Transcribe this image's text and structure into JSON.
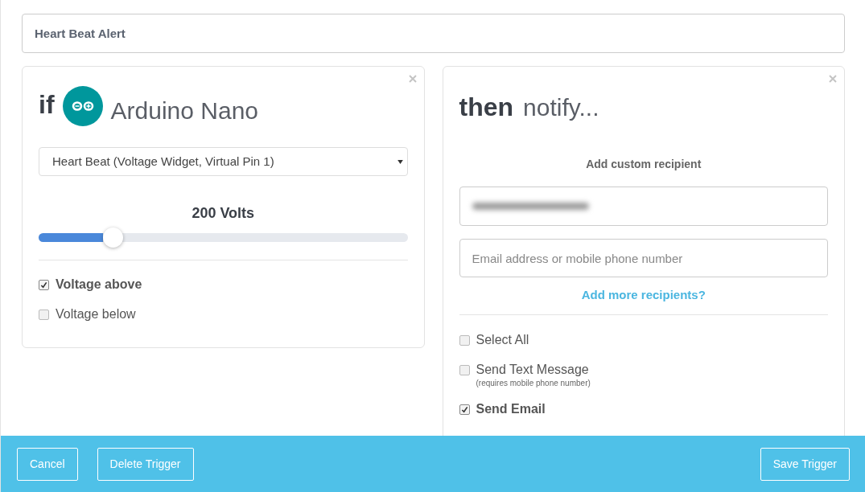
{
  "title_field": {
    "value": "Heart Beat Alert"
  },
  "condition": {
    "keyword": "if",
    "device": "Arduino Nano",
    "select": {
      "value": "Heart Beat (Voltage Widget, Virtual Pin 1)"
    },
    "threshold": {
      "reading": "200 Volts",
      "level": 0.2
    },
    "options": [
      {
        "label": "Voltage above",
        "checked": true
      },
      {
        "label": "Voltage below",
        "checked": false
      }
    ]
  },
  "action": {
    "keyword": "then",
    "verb": "notify...",
    "recipients_heading": "Add custom recipient",
    "recipients": [
      {
        "kind": "blurred"
      },
      {
        "kind": "input",
        "placeholder": "Email address or mobile phone number"
      }
    ],
    "add_more_link": "Add more recipients?",
    "options": [
      {
        "label": "Select All",
        "checked": false
      },
      {
        "label": "Send Text Message",
        "note": "(requires mobile phone number)",
        "checked": false
      },
      {
        "label": "Send Email",
        "checked": true
      }
    ]
  },
  "footer": {
    "buttons_left": [
      "Cancel",
      "Delete Trigger"
    ],
    "buttons_right": [
      "Save Trigger"
    ]
  }
}
